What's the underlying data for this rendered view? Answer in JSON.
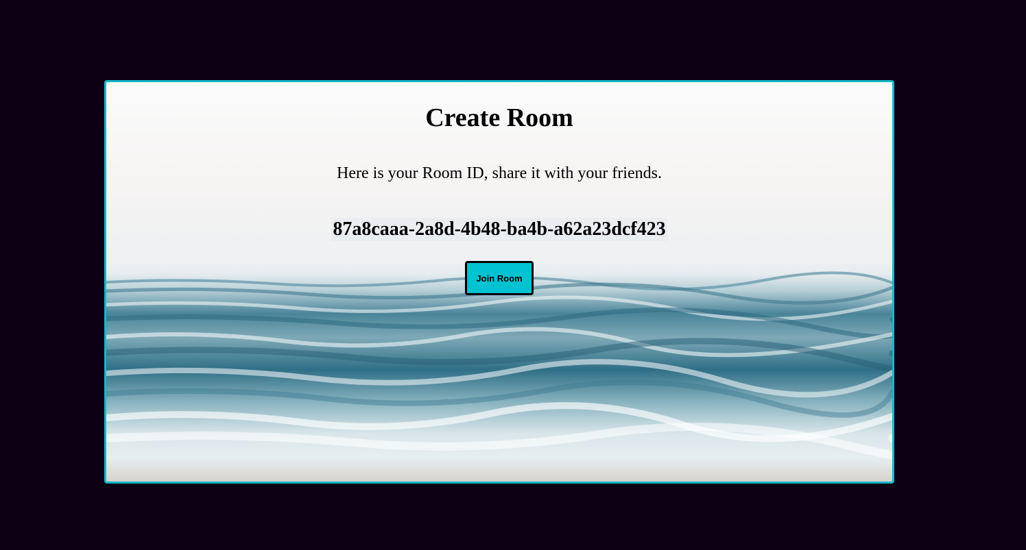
{
  "colors": {
    "page_background": "#0b0014",
    "card_border": "#14b8c8",
    "button_background": "#00c2d0",
    "button_border": "#000000"
  },
  "card": {
    "background_image": "ocean-waves-photo",
    "title": "Create Room",
    "subtitle": "Here is your Room ID, share it with your friends.",
    "room_id": "87a8caaa-2a8d-4b48-ba4b-a62a23dcf423",
    "join_label": "Join Room"
  }
}
